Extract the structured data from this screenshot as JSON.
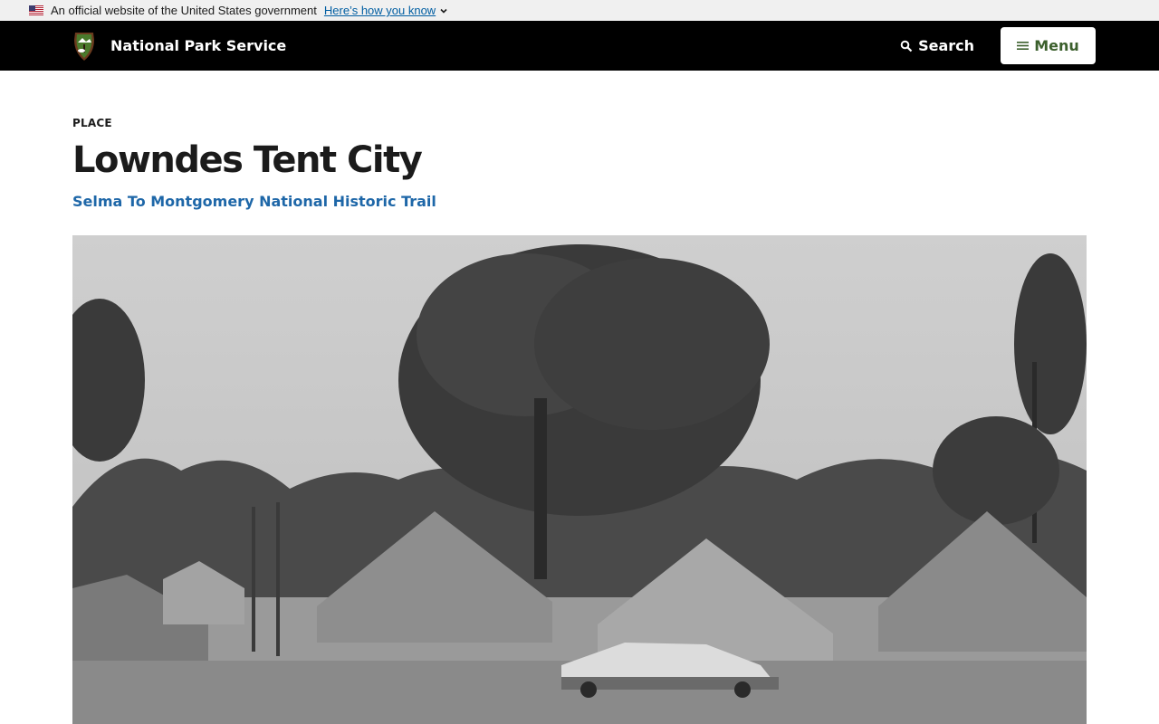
{
  "gov_banner": {
    "text": "An official website of the United States government",
    "link_label": "Here’s how you know"
  },
  "header": {
    "site_name": "National Park Service",
    "search_label": "Search",
    "menu_label": "Menu",
    "colors": {
      "background": "#000000",
      "menu_text": "#3b5f2c"
    }
  },
  "page": {
    "eyebrow": "PLACE",
    "title": "Lowndes Tent City",
    "park_link": "Selma To Montgomery National Historic Trail"
  },
  "hero_image": {
    "description_icon": "photo"
  }
}
